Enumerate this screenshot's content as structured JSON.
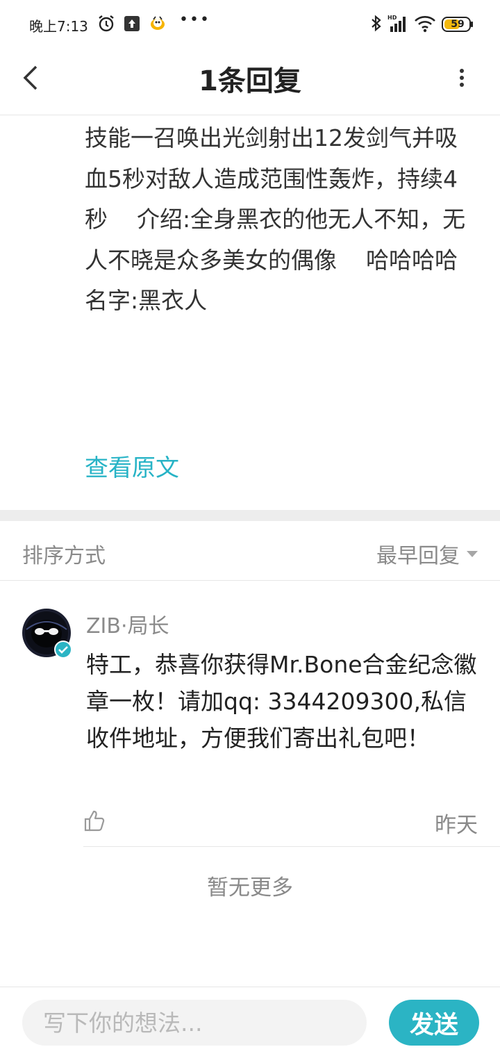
{
  "status_bar": {
    "time": "晚上7:13",
    "dots": "•••",
    "battery": "59",
    "icons": [
      "alarm-icon",
      "upload-icon",
      "app-notification-icon",
      "bluetooth-icon",
      "hd-signal-icon",
      "wifi-icon",
      "battery-icon"
    ]
  },
  "header": {
    "title": "1条回复",
    "back_icon": "chevron-left-icon",
    "more_icon": "more-vertical-icon"
  },
  "post": {
    "text": "技能一召唤出光剑射出12发剑气并吸血5秒对敌人造成范围性轰炸，持续4秒    介绍:全身黑衣的他无人不知，无人不晓是众多美女的偶像    哈哈哈哈    名字:黑衣人",
    "view_original": "查看原文"
  },
  "sort": {
    "label": "排序方式",
    "selected": "最早回复"
  },
  "comment": {
    "username": "ZIB·局长",
    "text": "特工，恭喜你获得Mr.Bone合金纪念徽章一枚！请加qq: 3344209300,私信收件地址，方便我们寄出礼包吧！",
    "time": "昨天",
    "verified": true
  },
  "list_end": "暂无更多",
  "composer": {
    "placeholder": "写下你的想法...",
    "send_label": "发送"
  },
  "colors": {
    "accent": "#27b3c6",
    "send_button": "#2bb4c4",
    "muted_text": "#8a8a8a"
  }
}
